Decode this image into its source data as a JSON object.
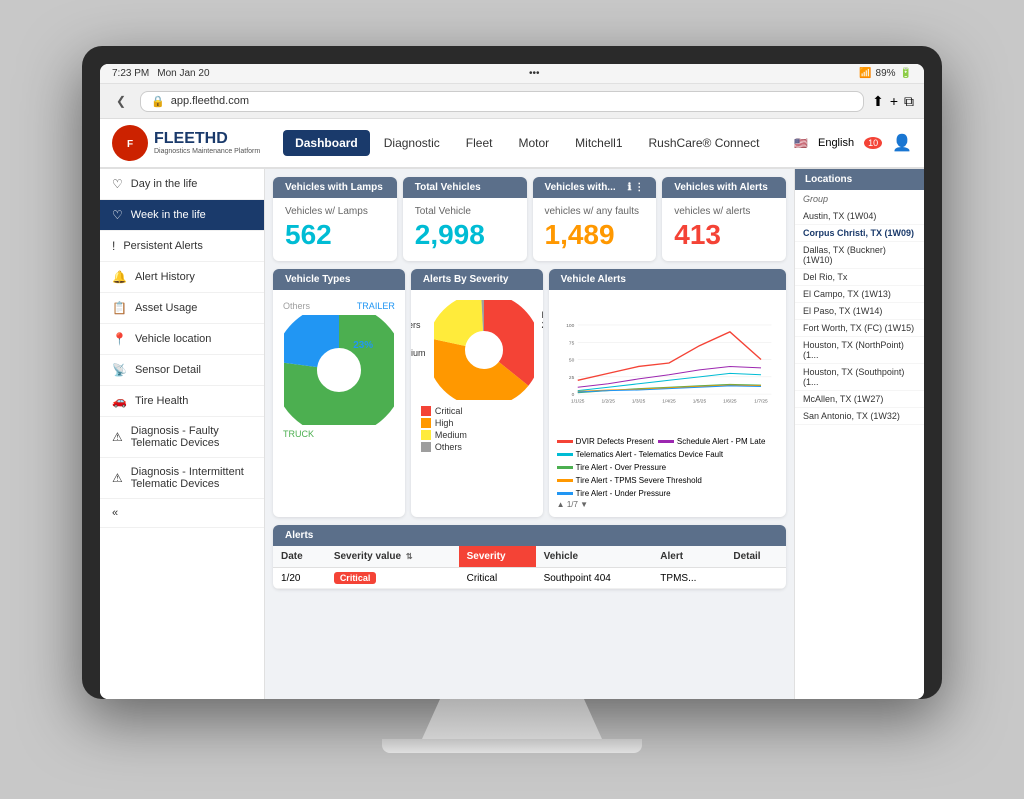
{
  "device": {
    "statusBar": {
      "time": "7:23 PM",
      "date": "Mon Jan 20",
      "wifi": "89%",
      "battery": "89%"
    },
    "browser": {
      "url": "app.fleethd.com",
      "dots": "•••"
    }
  },
  "app": {
    "logo": {
      "icon": "F",
      "name": "FLEETHD",
      "sub": "Diagnostics Maintenance Platform"
    },
    "nav": [
      {
        "label": "Dashboard",
        "active": true
      },
      {
        "label": "Diagnostic",
        "active": false
      },
      {
        "label": "Fleet",
        "active": false
      },
      {
        "label": "Motor",
        "active": false
      },
      {
        "label": "Mitchell1",
        "active": false
      },
      {
        "label": "RushCare® Connect",
        "active": false
      }
    ],
    "headerRight": {
      "language": "English",
      "notifCount": "10"
    }
  },
  "sidebar": {
    "items": [
      {
        "label": "Day in the life",
        "icon": "♡",
        "active": false
      },
      {
        "label": "Week in the life",
        "icon": "♡",
        "active": true
      },
      {
        "label": "Persistent Alerts",
        "icon": "!",
        "active": false
      },
      {
        "label": "Alert History",
        "icon": "🔔",
        "active": false
      },
      {
        "label": "Asset Usage",
        "icon": "📋",
        "active": false
      },
      {
        "label": "Vehicle location",
        "icon": "📍",
        "active": false
      },
      {
        "label": "Sensor Detail",
        "icon": "📡",
        "active": false
      },
      {
        "label": "Tire Health",
        "icon": "🚗",
        "active": false
      },
      {
        "label": "Diagnosis - Faulty Telematic Devices",
        "icon": "⚠",
        "active": false
      },
      {
        "label": "Diagnosis - Intermittent Telematic Devices",
        "icon": "⚠",
        "active": false
      }
    ]
  },
  "kpis": [
    {
      "header": "Vehicles with Lamps",
      "label": "Vehicles w/ Lamps",
      "value": "562",
      "colorClass": "cyan"
    },
    {
      "header": "Total Vehicles",
      "label": "Total Vehicle",
      "value": "2,998",
      "colorClass": "cyan"
    },
    {
      "header": "Vehicles with...",
      "label": "vehicles w/ any faults",
      "value": "1,489",
      "colorClass": "orange"
    },
    {
      "header": "Vehicles with Alerts",
      "label": "vehicles w/ alerts",
      "value": "413",
      "colorClass": "red"
    }
  ],
  "vehicleTypes": {
    "title": "Vehicle Types",
    "segments": [
      {
        "label": "TRUCK",
        "value": 77,
        "color": "#4caf50",
        "displayPct": "77%"
      },
      {
        "label": "TRAILER",
        "value": 23,
        "color": "#2196f3",
        "displayPct": "23%"
      },
      {
        "label": "Others",
        "value": 0,
        "color": "#9e9e9e",
        "displayPct": ""
      }
    ]
  },
  "alertsBySeverity": {
    "title": "Alerts By Severity",
    "segments": [
      {
        "label": "Critical",
        "value": 189,
        "color": "#f44336"
      },
      {
        "label": "High",
        "value": 225,
        "color": "#ff9800"
      },
      {
        "label": "Medium",
        "value": 110,
        "color": "#ffeb3b"
      },
      {
        "label": "Others",
        "value": 5,
        "color": "#9e9e9e"
      }
    ],
    "legend": [
      {
        "label": "Critical",
        "color": "#f44336"
      },
      {
        "label": "High",
        "color": "#ff9800"
      },
      {
        "label": "Medium",
        "color": "#ffeb3b"
      },
      {
        "label": "Others",
        "color": "#9e9e9e"
      }
    ]
  },
  "vehicleAlerts": {
    "title": "Vehicle Alerts",
    "yMax": 100,
    "xLabels": [
      "1/1/25",
      "1/2/25",
      "1/3/25",
      "1/4/25",
      "1/5/25",
      "1/6/25",
      "1/7/25"
    ],
    "legend": [
      {
        "label": "DVIR Defects Present",
        "color": "#f44336"
      },
      {
        "label": "Schedule Alert - PM Late",
        "color": "#9c27b0"
      },
      {
        "label": "Telematics Alert - Telematics Device Fault",
        "color": "#00bcd4"
      },
      {
        "label": "Tire Alert - Over Pressure",
        "color": "#4caf50"
      },
      {
        "label": "Tire Alert - TPMS Severe Threshold",
        "color": "#ff9800"
      },
      {
        "label": "Tire Alert - Under Pressure",
        "color": "#2196f3"
      }
    ]
  },
  "alerts": {
    "title": "Alerts",
    "columns": [
      "Date",
      "Severity value",
      "Severity",
      "Vehicle",
      "Alert",
      "Detail"
    ],
    "rows": [
      {
        "date": "1/20",
        "severityValue": "Critical",
        "severity": "Critical",
        "vehicle": "Southpoint 404",
        "alert": "TPMS...",
        "detail": "",
        "color": "#f44336"
      }
    ]
  },
  "locations": {
    "title": "Locations",
    "groupLabel": "Group",
    "items": [
      "Austin, TX (1W04)",
      "Corpus Christi, TX (1W09)",
      "Dallas, TX (Buckner) (1W10)",
      "Del Rio, Tx",
      "El Campo, TX (1W13)",
      "El Paso, TX (1W14)",
      "Fort Worth, TX (FC) (1W15)",
      "Houston, TX (NorthPoint) (1...",
      "Houston, TX (Southpoint) (1...",
      "McAllen, TX (1W27)",
      "San Antonio, TX (1W32)"
    ],
    "selectedIndex": 8
  }
}
